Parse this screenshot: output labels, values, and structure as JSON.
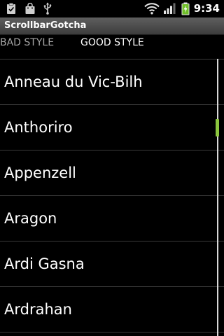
{
  "status_bar": {
    "time": "9:34",
    "icons": [
      "clipboard-icon",
      "shopping-bag-icon",
      "usb-icon",
      "wifi-icon",
      "signal-icon",
      "battery-charging-icon"
    ]
  },
  "app": {
    "title": "ScrollbarGotcha"
  },
  "tabs": [
    {
      "label": "BAD STYLE",
      "selected": false
    },
    {
      "label": "GOOD STYLE",
      "selected": true
    }
  ],
  "list": {
    "items": [
      {
        "label": "Anneau du Vic-Bilh"
      },
      {
        "label": "Anthoriro"
      },
      {
        "label": "Appenzell"
      },
      {
        "label": "Aragon"
      },
      {
        "label": "Ardi Gasna"
      },
      {
        "label": "Ardrahan"
      }
    ]
  },
  "scrollbar": {
    "thumb_color": "#8cc63e",
    "track_color": "#d8d8d8"
  },
  "colors": {
    "background": "#000000",
    "divider": "#3a3a3a",
    "text": "#ffffff",
    "inactive_tab": "#a8a8a8"
  }
}
